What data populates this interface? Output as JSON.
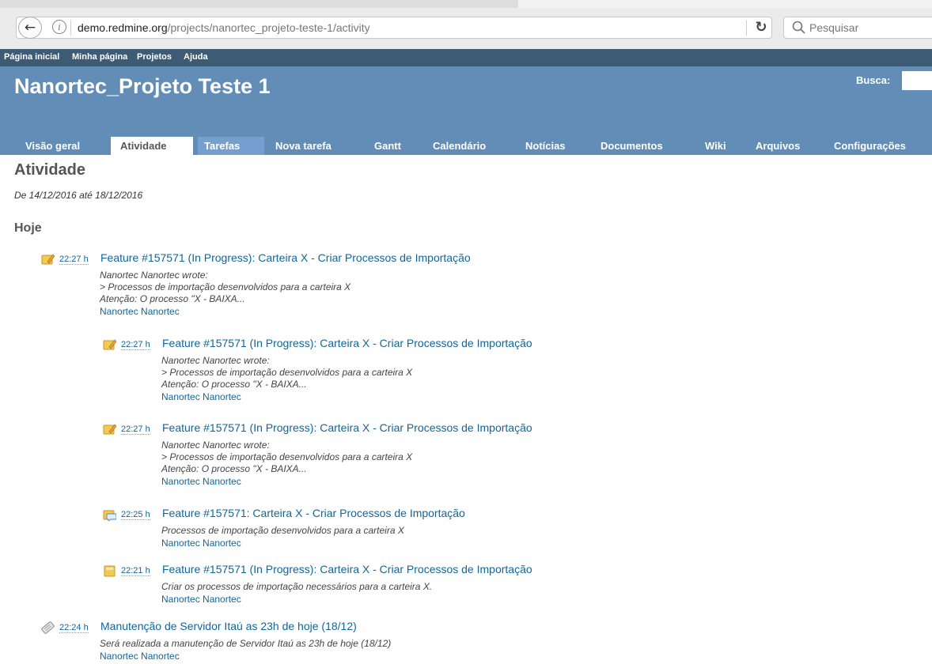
{
  "browser": {
    "url_domain": "demo.redmine.org",
    "url_path": "/projects/nanortec_projeto-teste-1/activity",
    "search_placeholder": "Pesquisar"
  },
  "top_menu": [
    "Página inicial",
    "Minha página",
    "Projetos",
    "Ajuda"
  ],
  "header": {
    "project_title": "Nanortec_Projeto Teste 1",
    "search_label": "Busca:"
  },
  "main_menu": [
    "Visão geral",
    "Atividade",
    "Tarefas",
    "Nova tarefa",
    "Gantt",
    "Calendário",
    "Notícias",
    "Documentos",
    "Wiki",
    "Arquivos",
    "Configurações"
  ],
  "page": {
    "title": "Atividade",
    "date_range": "De 14/12/2016 até 18/12/2016",
    "day_heading": "Hoje"
  },
  "entries": [
    {
      "icon": "issue-note-icon",
      "time": "22:27 h",
      "title": "Feature #157571 (In Progress): Carteira X - Criar Processos de Importação",
      "desc": [
        "Nanortec Nanortec wrote:",
        "> Processos de importação desenvolvidos para a carteira X",
        "Atenção: O processo \"X - BAIXA..."
      ],
      "author": "Nanortec Nanortec"
    },
    {
      "icon": "issue-note-icon",
      "time": "22:27 h",
      "title": "Feature #157571 (In Progress): Carteira X - Criar Processos de Importação",
      "desc": [
        "Nanortec Nanortec wrote:",
        "> Processos de importação desenvolvidos para a carteira X",
        "Atenção: O processo \"X - BAIXA..."
      ],
      "author": "Nanortec Nanortec"
    },
    {
      "icon": "issue-note-icon",
      "time": "22:27 h",
      "title": "Feature #157571 (In Progress): Carteira X - Criar Processos de Importação",
      "desc": [
        "Nanortec Nanortec wrote:",
        "> Processos de importação desenvolvidos para a carteira X",
        "Atenção: O processo \"X - BAIXA..."
      ],
      "author": "Nanortec Nanortec"
    },
    {
      "icon": "issue-edit-icon",
      "time": "22:25 h",
      "title": "Feature #157571: Carteira X - Criar Processos de Importação",
      "desc": [
        "Processos de importação desenvolvidos para a carteira X"
      ],
      "author": "Nanortec Nanortec"
    },
    {
      "icon": "issue-new-icon",
      "time": "22:21 h",
      "title": "Feature #157571 (In Progress): Carteira X - Criar Processos de Importação",
      "desc": [
        "Criar os processos de importação necessários para a carteira X."
      ],
      "author": "Nanortec Nanortec"
    },
    {
      "icon": "news-icon",
      "time": "22:24 h",
      "title": "Manutenção de Servidor Itaú as 23h de hoje (18/12)",
      "desc": [
        "Será realizada a manutenção de Servidor Itaú as 23h de hoje (18/12)"
      ],
      "author": "Nanortec Nanortec"
    }
  ]
}
